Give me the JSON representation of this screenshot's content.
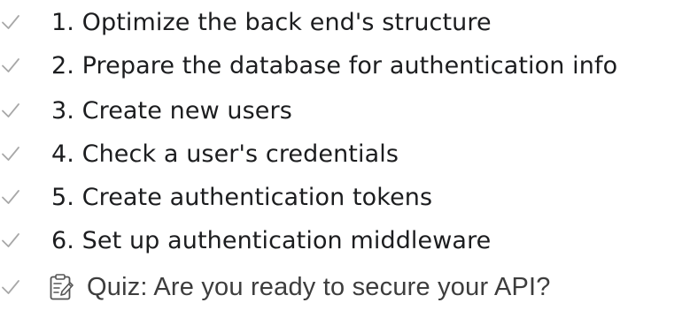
{
  "lessons": [
    {
      "label": "1. Optimize the back end's structure",
      "completed": true,
      "icon": "checkmark-icon"
    },
    {
      "label": "2. Prepare the database for authentication info",
      "completed": true,
      "icon": "checkmark-icon"
    },
    {
      "label": "3. Create new users",
      "completed": true,
      "icon": "checkmark-icon"
    },
    {
      "label": "4. Check a user's credentials",
      "completed": true,
      "icon": "checkmark-icon"
    },
    {
      "label": "5. Create authentication tokens",
      "completed": true,
      "icon": "checkmark-icon"
    },
    {
      "label": "6. Set up authentication middleware",
      "completed": true,
      "icon": "checkmark-icon"
    }
  ],
  "quiz": {
    "label": "Quiz: Are you ready to secure your API?",
    "completed": true,
    "icon": "quiz-clipboard-icon"
  },
  "colors": {
    "check": "#a8a8a8",
    "text": "#1c1d1f",
    "quiz_text": "#3d3d3d"
  }
}
